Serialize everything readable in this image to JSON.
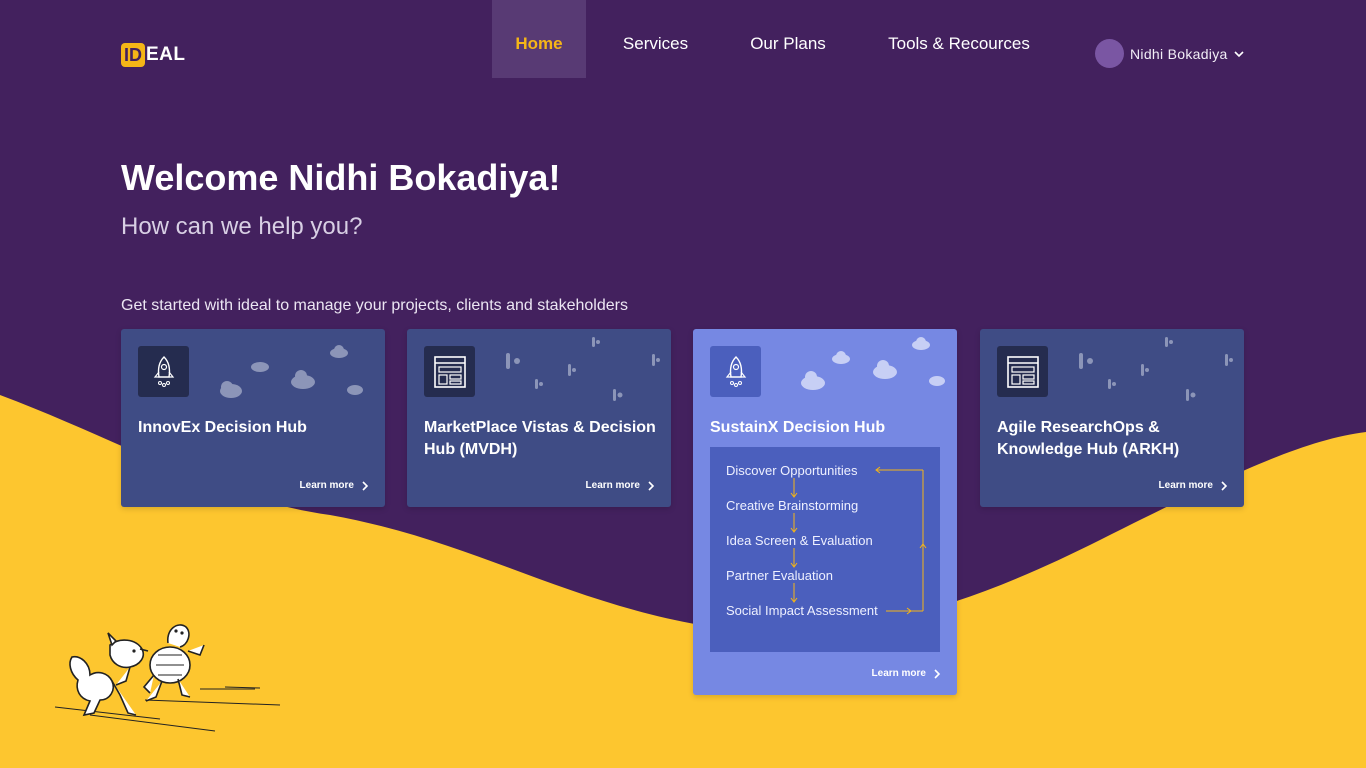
{
  "brand": {
    "logo_highlight": "ID",
    "logo_rest": "EAL",
    "accent": "#f5b517",
    "bg": "#43215e",
    "wave": "#fdc62f"
  },
  "nav": {
    "items": [
      "Home",
      "Services",
      "Our Plans",
      "Tools & Recources"
    ],
    "active": "Home"
  },
  "user": {
    "name": "Nidhi Bokadiya"
  },
  "hero": {
    "welcome": "Welcome Nidhi Bokadiya!",
    "subtitle": "How can we help you?",
    "intro": "Get started with ideal to manage your projects, clients and stakeholders"
  },
  "cards": [
    {
      "title": "InnovEx Decision Hub",
      "learn": "Learn more",
      "icon": "rocket-icon"
    },
    {
      "title": "MarketPlace Vistas & Decision Hub (MVDH)",
      "learn": "Learn more",
      "icon": "layout-icon"
    },
    {
      "title": "SustainX Decision Hub",
      "learn": "Learn more",
      "icon": "rocket-icon",
      "steps": [
        "Discover Opportunities",
        "Creative Brainstorming",
        "Idea Screen & Evaluation",
        "Partner Evaluation",
        "Social Impact Assessment"
      ]
    },
    {
      "title": "Agile  ResearchOps & Knowledge Hub (ARKH)",
      "learn": "Learn more",
      "icon": "layout-icon"
    }
  ]
}
